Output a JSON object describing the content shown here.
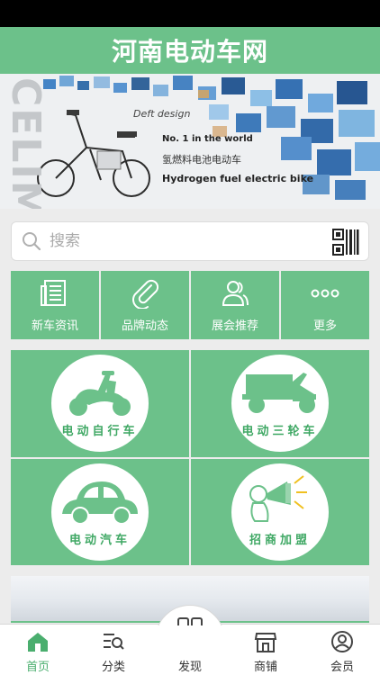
{
  "header": {
    "title": "河南电动车网"
  },
  "banner": {
    "side_text": "CELIM",
    "tagline": "Deft design",
    "headline": "No. 1 in the world",
    "cn_caption": "氢燃料电池电动车",
    "en_caption": "Hydrogen fuel electric bike"
  },
  "search": {
    "placeholder": "搜索"
  },
  "nav": [
    {
      "label": "新车资讯",
      "icon": "newspaper-icon"
    },
    {
      "label": "品牌动态",
      "icon": "paperclip-icon"
    },
    {
      "label": "展会推荐",
      "icon": "people-icon"
    },
    {
      "label": "更多",
      "icon": "more-dots-icon"
    }
  ],
  "categories": [
    {
      "label": "电动自行车",
      "icon": "scooter-icon"
    },
    {
      "label": "电动三轮车",
      "icon": "tricycle-icon"
    },
    {
      "label": "电动汽车",
      "icon": "car-icon"
    },
    {
      "label": "招商加盟",
      "icon": "megaphone-icon"
    }
  ],
  "tabs": [
    {
      "label": "首页",
      "icon": "home-icon",
      "active": true
    },
    {
      "label": "分类",
      "icon": "category-search-icon",
      "active": false
    },
    {
      "label": "发现",
      "icon": "grid-icon",
      "active": false
    },
    {
      "label": "商铺",
      "icon": "shop-icon",
      "active": false
    },
    {
      "label": "会员",
      "icon": "user-icon",
      "active": false
    }
  ],
  "colors": {
    "brand": "#6cc18a",
    "active_tab": "#4aae6e",
    "category_text": "#3fa864"
  }
}
